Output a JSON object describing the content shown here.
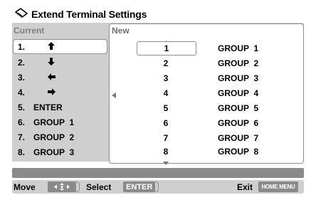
{
  "title": "Extend Terminal Settings",
  "icon": "remote-control-icon",
  "current": {
    "header": "Current",
    "items": [
      {
        "num": "1.",
        "label": "",
        "icon": "arrow-up-icon",
        "glyph": "⬆"
      },
      {
        "num": "2.",
        "label": "",
        "icon": "arrow-down-icon",
        "glyph": "⬇"
      },
      {
        "num": "3.",
        "label": "",
        "icon": "arrow-left-icon",
        "glyph": "⬅"
      },
      {
        "num": "4.",
        "label": "",
        "icon": "arrow-right-icon",
        "glyph": "➡"
      },
      {
        "num": "5.",
        "label": "ENTER"
      },
      {
        "num": "6.",
        "label": "GROUP  1"
      },
      {
        "num": "7.",
        "label": "GROUP  2"
      },
      {
        "num": "8.",
        "label": "GROUP  3"
      }
    ]
  },
  "new": {
    "header": "New",
    "rows": [
      {
        "n": "1",
        "group": "GROUP  1"
      },
      {
        "n": "2",
        "group": "GROUP  2"
      },
      {
        "n": "3",
        "group": "GROUP  3"
      },
      {
        "n": "4",
        "group": "GROUP  4"
      },
      {
        "n": "5",
        "group": "GROUP  5"
      },
      {
        "n": "6",
        "group": "GROUP  6"
      },
      {
        "n": "7",
        "group": "GROUP  7"
      },
      {
        "n": "8",
        "group": "GROUP  8"
      }
    ]
  },
  "bottom": {
    "move_label": "Move",
    "move_key": "←↑↓→",
    "select_label": "Select",
    "select_key": "ENTER",
    "exit_label": "Exit",
    "exit_key": "HOME MENU"
  },
  "colors": {
    "panel_gray": "#cfcfcf",
    "key_gray": "#8a8a8a",
    "header_gray": "#7f7f7f"
  }
}
